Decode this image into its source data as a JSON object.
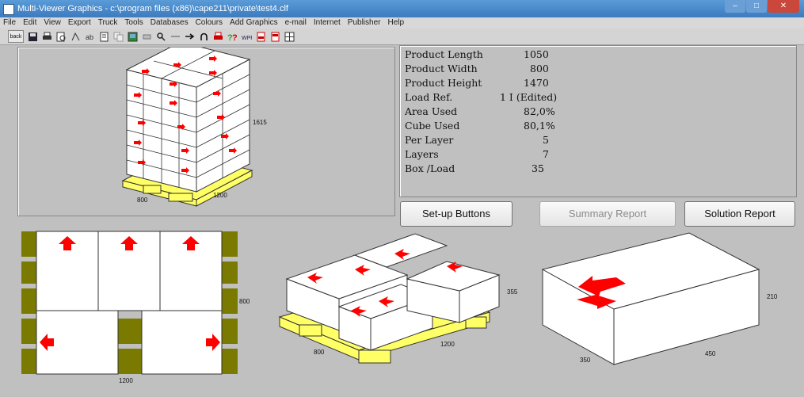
{
  "window": {
    "title": "Multi-Viewer Graphics - c:\\program files (x86)\\cape211\\private\\test4.clf",
    "minimize": "–",
    "maximize": "□",
    "close": "✕"
  },
  "menu": [
    "File",
    "Edit",
    "View",
    "Export",
    "Truck",
    "Tools",
    "Databases",
    "Colours",
    "Add Graphics",
    "e-mail",
    "Internet",
    "Publisher",
    "Help"
  ],
  "toolbar": {
    "back_label": "back",
    "icons": [
      "back-icon",
      "save-icon",
      "print-icon",
      "print-preview-icon",
      "pallet-icon",
      "text-icon",
      "report-icon",
      "copy-icon",
      "image-icon",
      "layer-icon",
      "zoom-icon",
      "pipe-icon",
      "arrow-right-icon",
      "rotate-icon",
      "printer-red-icon",
      "help-icon",
      "wpf-icon",
      "pdf-icon",
      "pdf-icon-2",
      "grid-icon"
    ]
  },
  "info": {
    "rows": [
      {
        "label": "Product Length",
        "value": "1050"
      },
      {
        "label": "Product Width",
        "value": "800"
      },
      {
        "label": "Product Height",
        "value": "1470"
      },
      {
        "label": "Load Ref.",
        "value": "1 I (Edited)"
      },
      {
        "label": "Area Used",
        "value": "82,0%"
      },
      {
        "label": "Cube Used",
        "value": "80,1%"
      },
      {
        "label": "Per Layer",
        "value": "5"
      },
      {
        "label": "Layers",
        "value": "7"
      },
      {
        "label": "Box /Load",
        "value": "35"
      }
    ]
  },
  "buttons": {
    "setup": "Set-up Buttons",
    "summary": "Summary Report",
    "solution": "Solution Report"
  },
  "dims": {
    "load_height": "1615",
    "load_length": "1200",
    "load_width": "800",
    "plan_width": "800",
    "plan_length": "1200",
    "layer_height": "355",
    "layer_length": "1200",
    "layer_width": "800",
    "box_height": "210",
    "box_width": "350",
    "box_length": "450"
  },
  "colors": {
    "pallet": "#ffff66",
    "pallet_dark": "#7a7a00",
    "arrow": "#ff0000",
    "box": "#ffffff"
  }
}
